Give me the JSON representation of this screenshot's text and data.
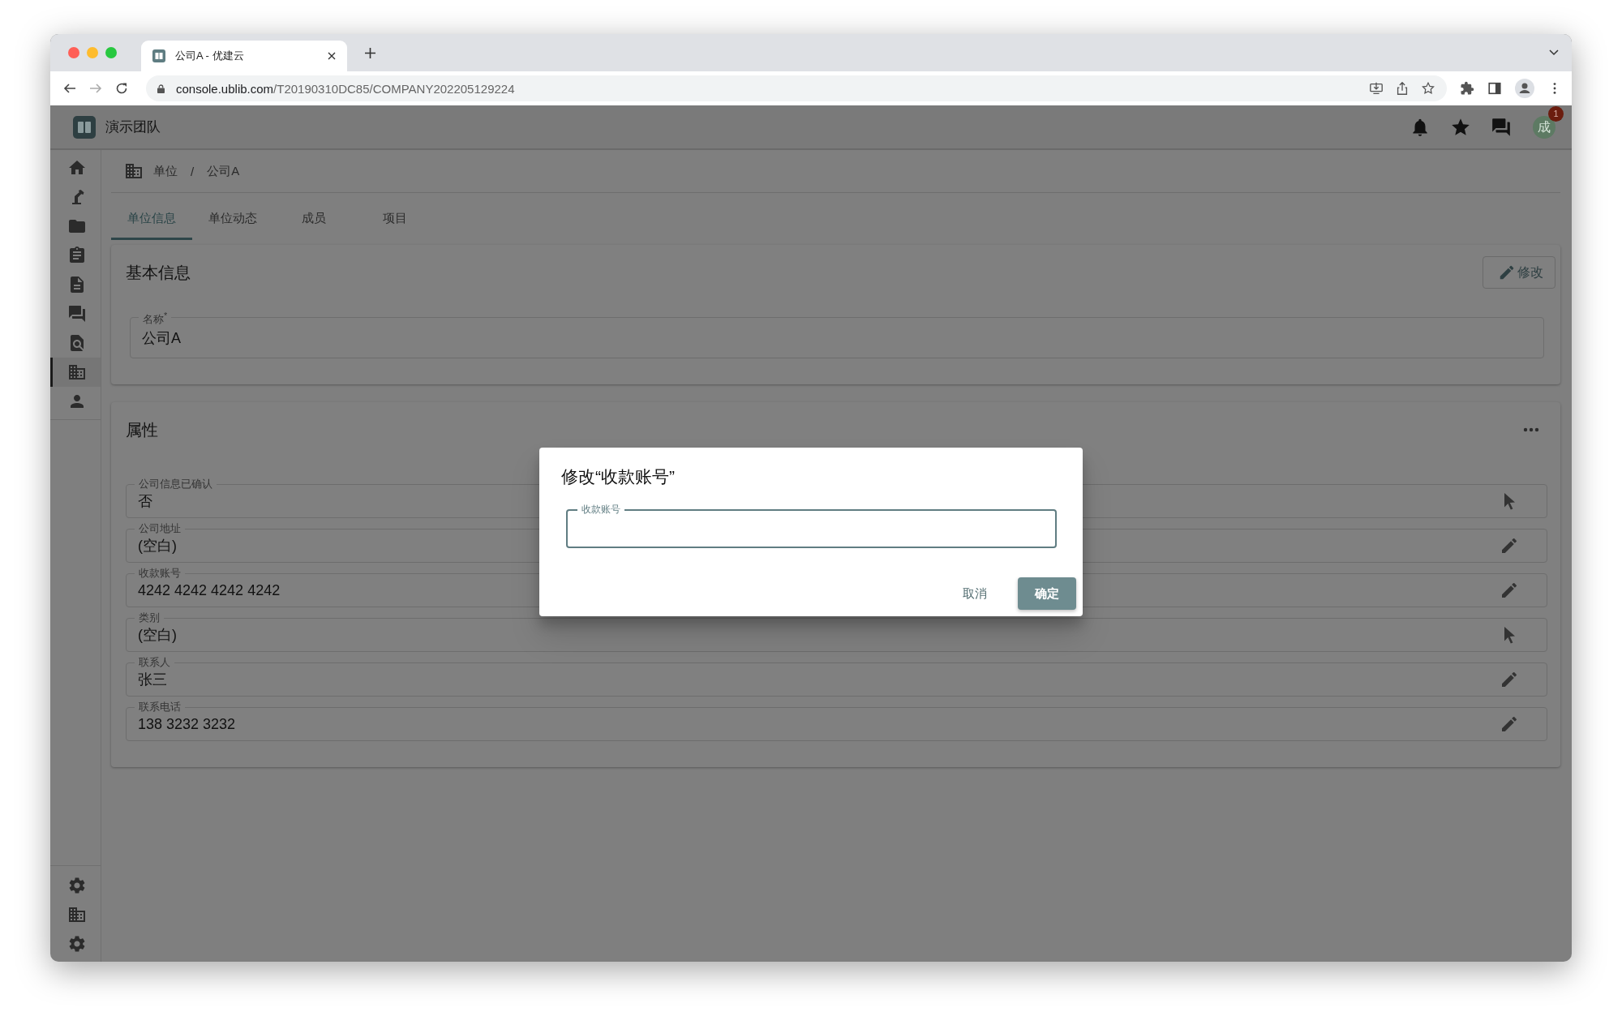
{
  "browser": {
    "tab_title": "公司A - 优建云",
    "url_host": "console.ublib.com",
    "url_path": "/T20190310DC85/COMPANY202205129224"
  },
  "app": {
    "team": "演示团队",
    "avatar": "成",
    "notification_count": "1"
  },
  "sidebar": {
    "items": [
      {
        "kind": "home",
        "selected": false
      },
      {
        "kind": "lamp",
        "selected": false
      },
      {
        "kind": "folder",
        "selected": false
      },
      {
        "kind": "clipboard",
        "selected": false
      },
      {
        "kind": "document",
        "selected": false
      },
      {
        "kind": "chat",
        "selected": false
      },
      {
        "kind": "find",
        "selected": false
      },
      {
        "kind": "building",
        "selected": true
      },
      {
        "kind": "person",
        "selected": false
      }
    ],
    "bottom_items": [
      {
        "kind": "settings"
      },
      {
        "kind": "building"
      },
      {
        "kind": "settings"
      }
    ]
  },
  "breadcrumb": [
    "单位",
    "公司A"
  ],
  "breadcrumb_separator": "/",
  "tabs": [
    {
      "label": "单位信息",
      "selected": true
    },
    {
      "label": "单位动态",
      "selected": false
    },
    {
      "label": "成员",
      "selected": false
    },
    {
      "label": "项目",
      "selected": false
    }
  ],
  "basic_info": {
    "title": "基本信息",
    "edit_button": "修改",
    "name_field": {
      "label": "名称$^{*}$",
      "value": "公司A"
    }
  },
  "properties": {
    "title": "属性",
    "fields": [
      {
        "label": "公司信息已确认",
        "value": "否",
        "kind": "select"
      },
      {
        "label": "公司地址",
        "value": "(空白)",
        "kind": "edit"
      },
      {
        "label": "收款账号",
        "value": "4242 4242 4242 4242",
        "kind": "edit"
      },
      {
        "label": "类别",
        "value": "(空白)",
        "kind": "select"
      },
      {
        "label": "联系人",
        "value": "张三",
        "kind": "edit"
      },
      {
        "label": "联系电话",
        "value": "138 3232 3232",
        "kind": "edit"
      }
    ]
  },
  "dialog": {
    "title": "修改“收款账号”",
    "field": {
      "label": "收款账号"
    },
    "cancel_button": "取消",
    "confirm_button": "确定"
  }
}
